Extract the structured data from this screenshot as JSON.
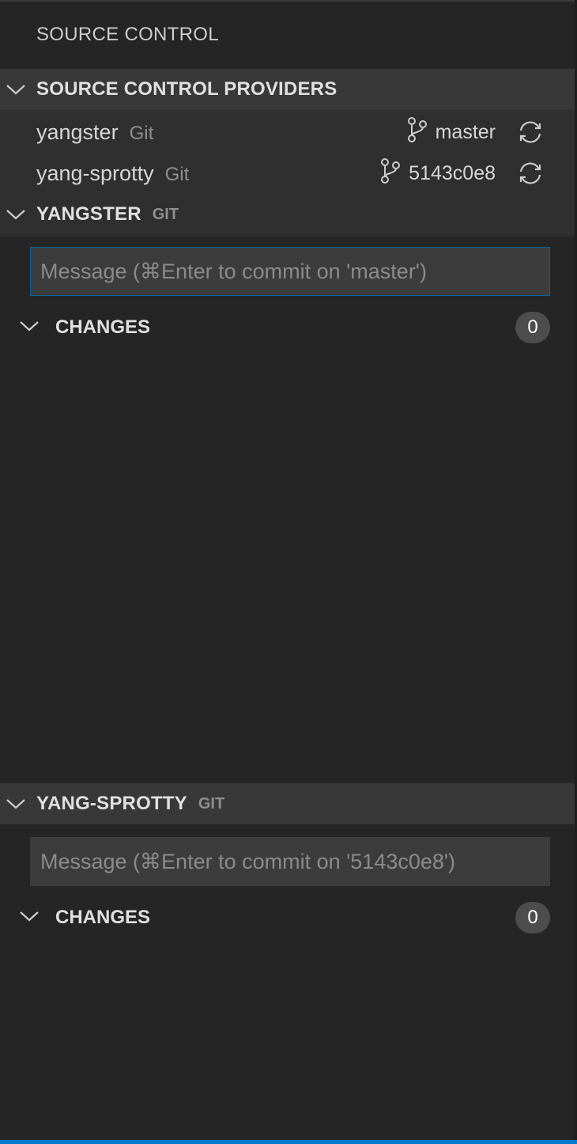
{
  "view": {
    "title": "SOURCE CONTROL"
  },
  "providers_section": {
    "title": "SOURCE CONTROL PROVIDERS",
    "items": [
      {
        "name": "yangster",
        "type": "Git",
        "branch": "master",
        "branch_icon": "git-branch-icon",
        "sync_icon": "sync-icon"
      },
      {
        "name": "yang-sprotty",
        "type": "Git",
        "branch": "5143c0e8",
        "branch_icon": "git-branch-icon",
        "sync_icon": "sync-icon"
      }
    ]
  },
  "repos": [
    {
      "title": "YANGSTER",
      "provider": "GIT",
      "commit_placeholder": "Message (⌘Enter to commit on 'master')",
      "changes_label": "CHANGES",
      "changes_count": "0"
    },
    {
      "title": "YANG-SPROTTY",
      "provider": "GIT",
      "commit_placeholder": "Message (⌘Enter to commit on '5143c0e8')",
      "changes_label": "CHANGES",
      "changes_count": "0"
    }
  ],
  "colors": {
    "background": "#252526",
    "section_header": "#383838",
    "input_background": "#3c3c3c",
    "focus_border": "#0e639c",
    "status_bar": "#007acc",
    "badge": "#4d4d4d"
  }
}
